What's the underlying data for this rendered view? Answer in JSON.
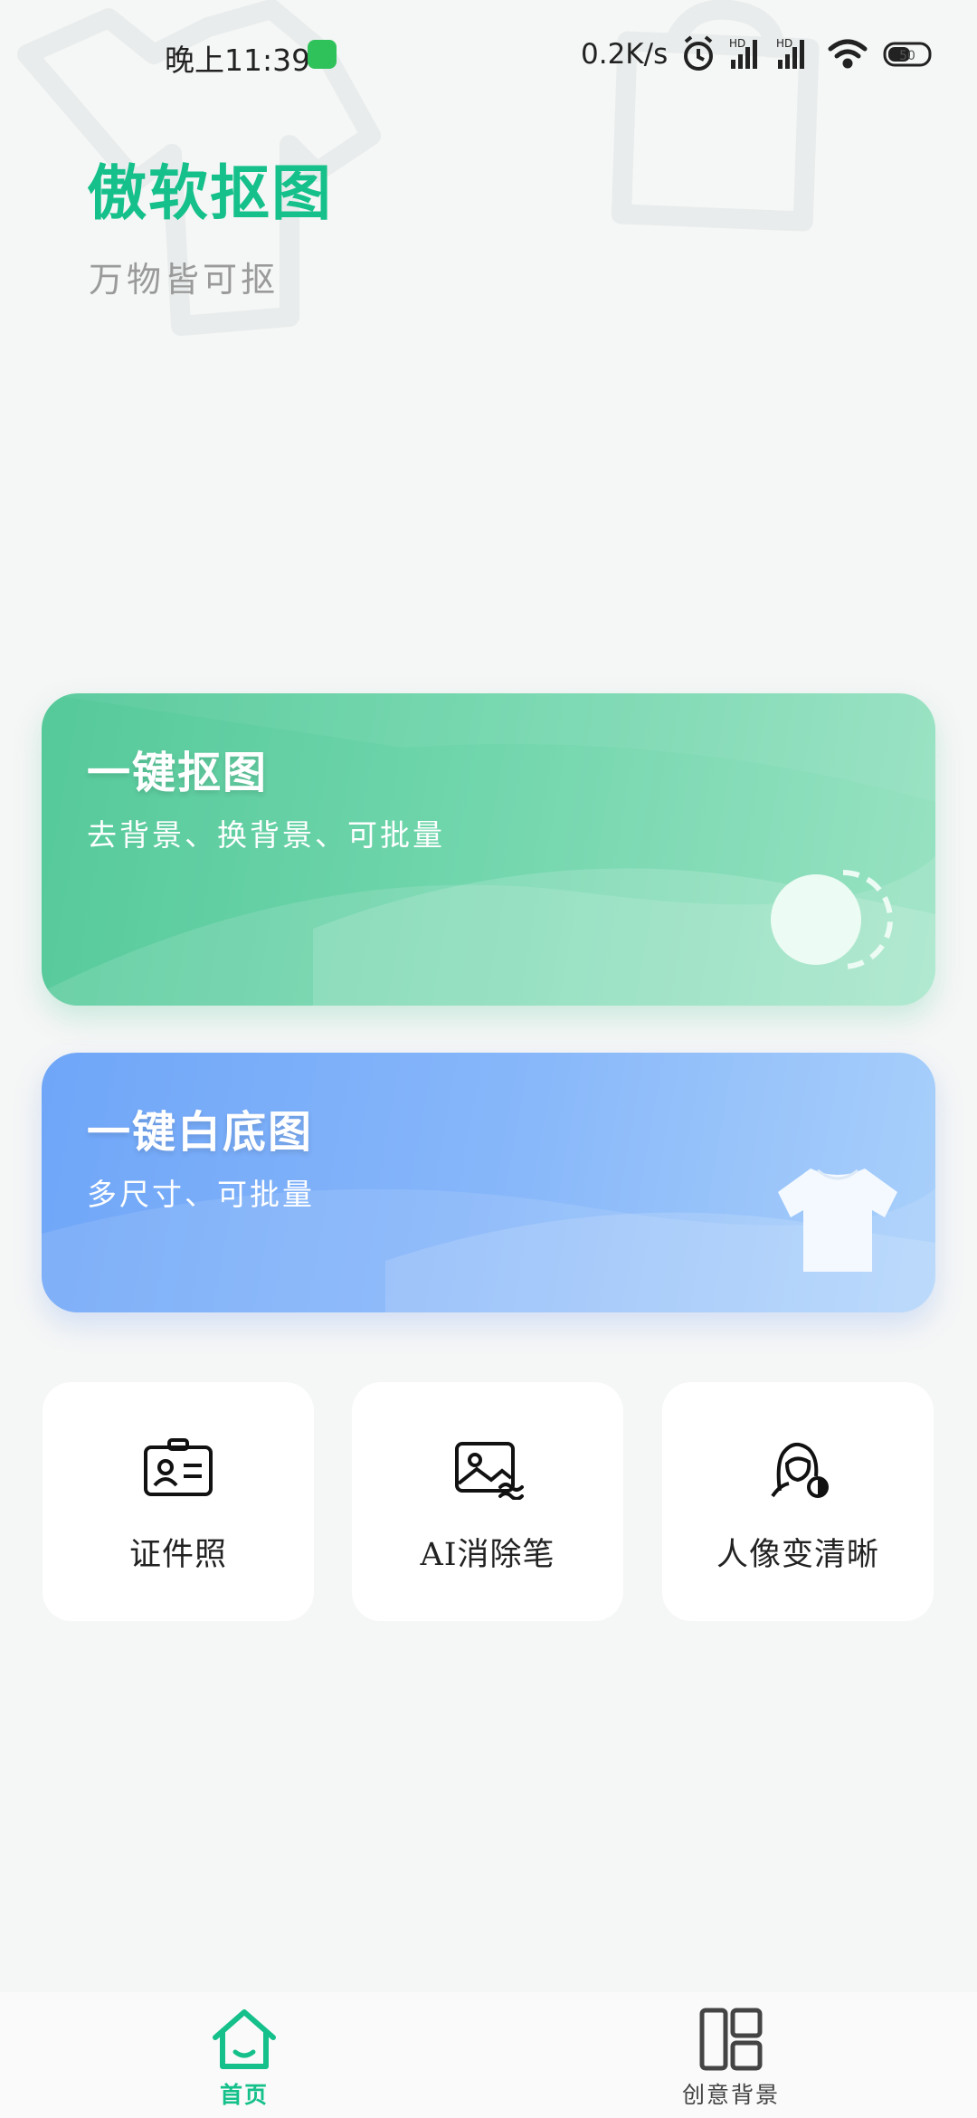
{
  "status_bar": {
    "time": "晚上11:39",
    "net_speed": "0.2K/s",
    "battery": "50",
    "icons": [
      "vpn-shield-icon",
      "alarm-icon",
      "hd-signal-icon",
      "hd-signal-icon",
      "wifi-icon",
      "battery-icon"
    ]
  },
  "header": {
    "app_title": "傲软抠图",
    "slogan": "万物皆可抠"
  },
  "cards": {
    "cutout": {
      "title": "一键抠图",
      "subtitle": "去背景、换背景、可批量",
      "icon": "cutout-circle-icon",
      "colors": [
        "#55c99a",
        "#98e2c2"
      ]
    },
    "white_bg": {
      "title": "一键白底图",
      "subtitle": "多尺寸、可批量",
      "icon": "tshirt-icon",
      "colors": [
        "#6fa6f8",
        "#a9d0fb"
      ]
    }
  },
  "tools": [
    {
      "label": "证件照",
      "icon": "id-card-icon"
    },
    {
      "label": "AI消除笔",
      "icon": "image-eraser-icon"
    },
    {
      "label": "人像变清晰",
      "icon": "portrait-enhance-icon"
    }
  ],
  "bottom_nav": {
    "items": [
      {
        "label": "首页",
        "icon": "home-icon",
        "active": true
      },
      {
        "label": "创意背景",
        "icon": "layout-icon",
        "active": false
      }
    ]
  },
  "colors": {
    "brand": "#16c08a",
    "background": "#f5f6f6"
  }
}
